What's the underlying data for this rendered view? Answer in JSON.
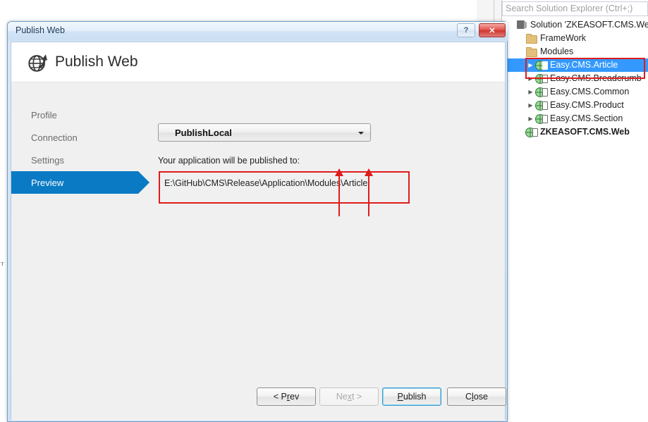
{
  "solution_explorer": {
    "toolbar": {
      "divide_icon": "divide-icon",
      "warning_icon": "warning-icon"
    },
    "search": {
      "placeholder": "Search Solution Explorer (Ctrl+;)",
      "value": ""
    },
    "tree": [
      {
        "label": "Solution 'ZKEASOFT.CMS.Web'",
        "icon": "solution-icon",
        "indent": 0,
        "expander": "",
        "bold": false,
        "selected": false
      },
      {
        "label": "FrameWork",
        "icon": "folder-icon",
        "indent": 1,
        "expander": "",
        "bold": false,
        "selected": false
      },
      {
        "label": "Modules",
        "icon": "folder-icon",
        "indent": 1,
        "expander": "",
        "bold": false,
        "selected": false
      },
      {
        "label": "Easy.CMS.Article",
        "icon": "web-project-icon",
        "indent": 2,
        "expander": "▶",
        "bold": false,
        "selected": true
      },
      {
        "label": "Easy.CMS.Breadcrumb",
        "icon": "web-project-icon",
        "indent": 2,
        "expander": "▶",
        "bold": false,
        "selected": false
      },
      {
        "label": "Easy.CMS.Common",
        "icon": "web-project-icon",
        "indent": 2,
        "expander": "▶",
        "bold": false,
        "selected": false
      },
      {
        "label": "Easy.CMS.Product",
        "icon": "web-project-icon",
        "indent": 2,
        "expander": "▶",
        "bold": false,
        "selected": false
      },
      {
        "label": "Easy.CMS.Section",
        "icon": "web-project-icon",
        "indent": 2,
        "expander": "▶",
        "bold": false,
        "selected": false
      },
      {
        "label": "ZKEASOFT.CMS.Web",
        "icon": "web-project-icon",
        "indent": 1,
        "expander": "",
        "bold": true,
        "selected": false
      }
    ]
  },
  "dialog": {
    "titlebar": {
      "title": "Publish Web",
      "help_label": "?",
      "close_label": "✕"
    },
    "header": {
      "heading": "Publish Web",
      "icon": "globe-publish-icon"
    },
    "nav": [
      {
        "label": "Profile",
        "active": false
      },
      {
        "label": "Connection",
        "active": false
      },
      {
        "label": "Settings",
        "active": false
      },
      {
        "label": "Preview",
        "active": true
      }
    ],
    "profile_combo": {
      "value": "PublishLocal",
      "arrow_icon": "chevron-down-icon"
    },
    "publish_label": "Your application will be published to:",
    "publish_path": "E:\\GitHub\\CMS\\Release\\Application\\Modules\\Article",
    "footer_buttons": [
      {
        "id": "prev",
        "pre": "< P",
        "accel": "r",
        "post": "ev",
        "state": "normal"
      },
      {
        "id": "next",
        "pre": "Ne",
        "accel": "x",
        "post": "t >",
        "state": "disabled"
      },
      {
        "id": "publish",
        "pre": "",
        "accel": "P",
        "post": "ublish",
        "state": "focused"
      },
      {
        "id": "close",
        "pre": "C",
        "accel": "l",
        "post": "ose",
        "state": "normal"
      }
    ]
  },
  "annotations": {
    "accent_color": "#e01b1b",
    "path_rect": true,
    "tree_rect": true,
    "arrow_count": 2
  },
  "left_edge_glyph": "ᴛ"
}
